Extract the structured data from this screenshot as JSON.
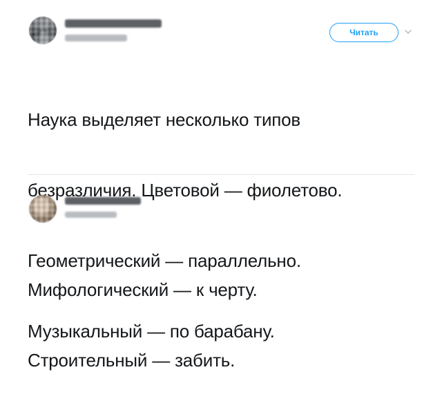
{
  "tweets": [
    {
      "follow_label": "Читать",
      "lines": [
        "Наука выделяет несколько типов",
        "безразличия. Цветовой — фиолетово.",
        "Геометрический — параллельно.",
        "Музыкальный — по барабану."
      ]
    },
    {
      "lines": [
        "Мифологический — к черту.",
        "Строительный — забить."
      ]
    }
  ],
  "colors": {
    "accent": "#1da1f2",
    "text": "#14171a",
    "divider": "#e1e8ed",
    "chevron": "#aab8c2"
  },
  "icons": {
    "menu": "chevron-down-icon"
  }
}
